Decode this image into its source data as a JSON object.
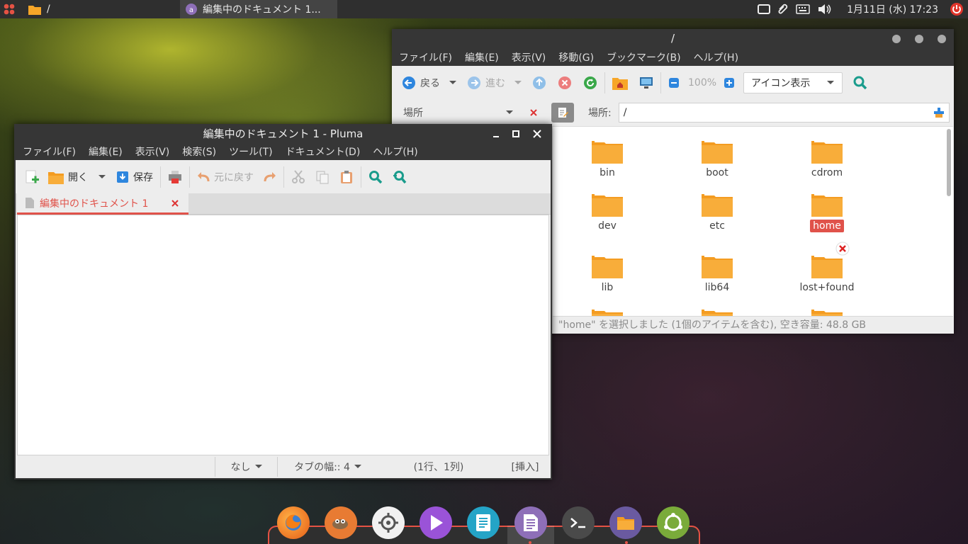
{
  "top_panel": {
    "places_label": "/",
    "task_title": "編集中のドキュメント 1...",
    "clock": "1月11日 (水) 17:23"
  },
  "file_manager": {
    "title": "/",
    "menu": [
      "ファイル(F)",
      "編集(E)",
      "表示(V)",
      "移動(G)",
      "ブックマーク(B)",
      "ヘルプ(H)"
    ],
    "toolbar": {
      "back": "戻る",
      "forward": "進む",
      "zoom": "100%",
      "view_mode": "アイコン表示"
    },
    "sidebar_label": "場所",
    "location_label": "場所:",
    "location_value": "/",
    "folders": [
      "bin",
      "boot",
      "cdrom",
      "dev",
      "etc",
      "home",
      "lib",
      "lib64",
      "lost+found"
    ],
    "selected_folder": "home",
    "status": "\"home\" を選択しました (1個のアイテムを含む), 空き容量: 48.8 GB"
  },
  "editor": {
    "title": "編集中のドキュメント 1 - Pluma",
    "menu": [
      "ファイル(F)",
      "編集(E)",
      "表示(V)",
      "検索(S)",
      "ツール(T)",
      "ドキュメント(D)",
      "ヘルプ(H)"
    ],
    "toolbar": {
      "open": "開く",
      "save": "保存",
      "undo": "元に戻す"
    },
    "tab_label": "編集中のドキュメント 1",
    "status": {
      "highlight_mode": "なし",
      "tab_width": "タブの幅:: 4",
      "position": "(1行、1列)",
      "insert_mode": "[挿入]"
    }
  },
  "dock": {
    "apps": [
      "firefox-icon",
      "gimp-icon",
      "settings-icon",
      "media-player-icon",
      "text-document-icon",
      "pluma-icon",
      "terminal-icon",
      "files-icon",
      "ubuntu-mate-icon"
    ],
    "colors": {
      "accent": "#e55244",
      "folder": "#f7a628"
    }
  }
}
